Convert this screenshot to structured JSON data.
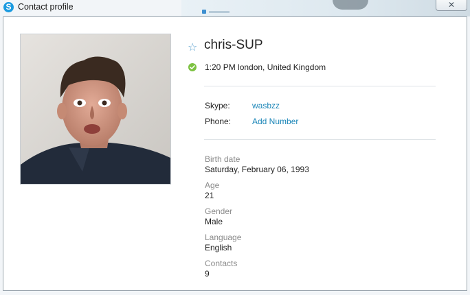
{
  "window": {
    "title": "Contact profile",
    "app_icon_glyph": "S",
    "close_glyph": "✕"
  },
  "profile": {
    "display_name": "chris-SUP",
    "local_time": "1:20 PM london, United Kingdom",
    "status": "online",
    "favorite_icon": "star-outline-icon"
  },
  "contact_methods": {
    "skype_label": "Skype:",
    "skype_value": "wasbzz",
    "phone_label": "Phone:",
    "phone_value": "Add Number"
  },
  "details": {
    "birth_date_label": "Birth date",
    "birth_date_value": "Saturday, February 06, 1993",
    "age_label": "Age",
    "age_value": "21",
    "gender_label": "Gender",
    "gender_value": "Male",
    "language_label": "Language",
    "language_value": "English",
    "contacts_label": "Contacts",
    "contacts_value": "9"
  },
  "colors": {
    "link": "#1b86b8",
    "status_online": "#7dc242",
    "skype_blue": "#1b9be0"
  }
}
